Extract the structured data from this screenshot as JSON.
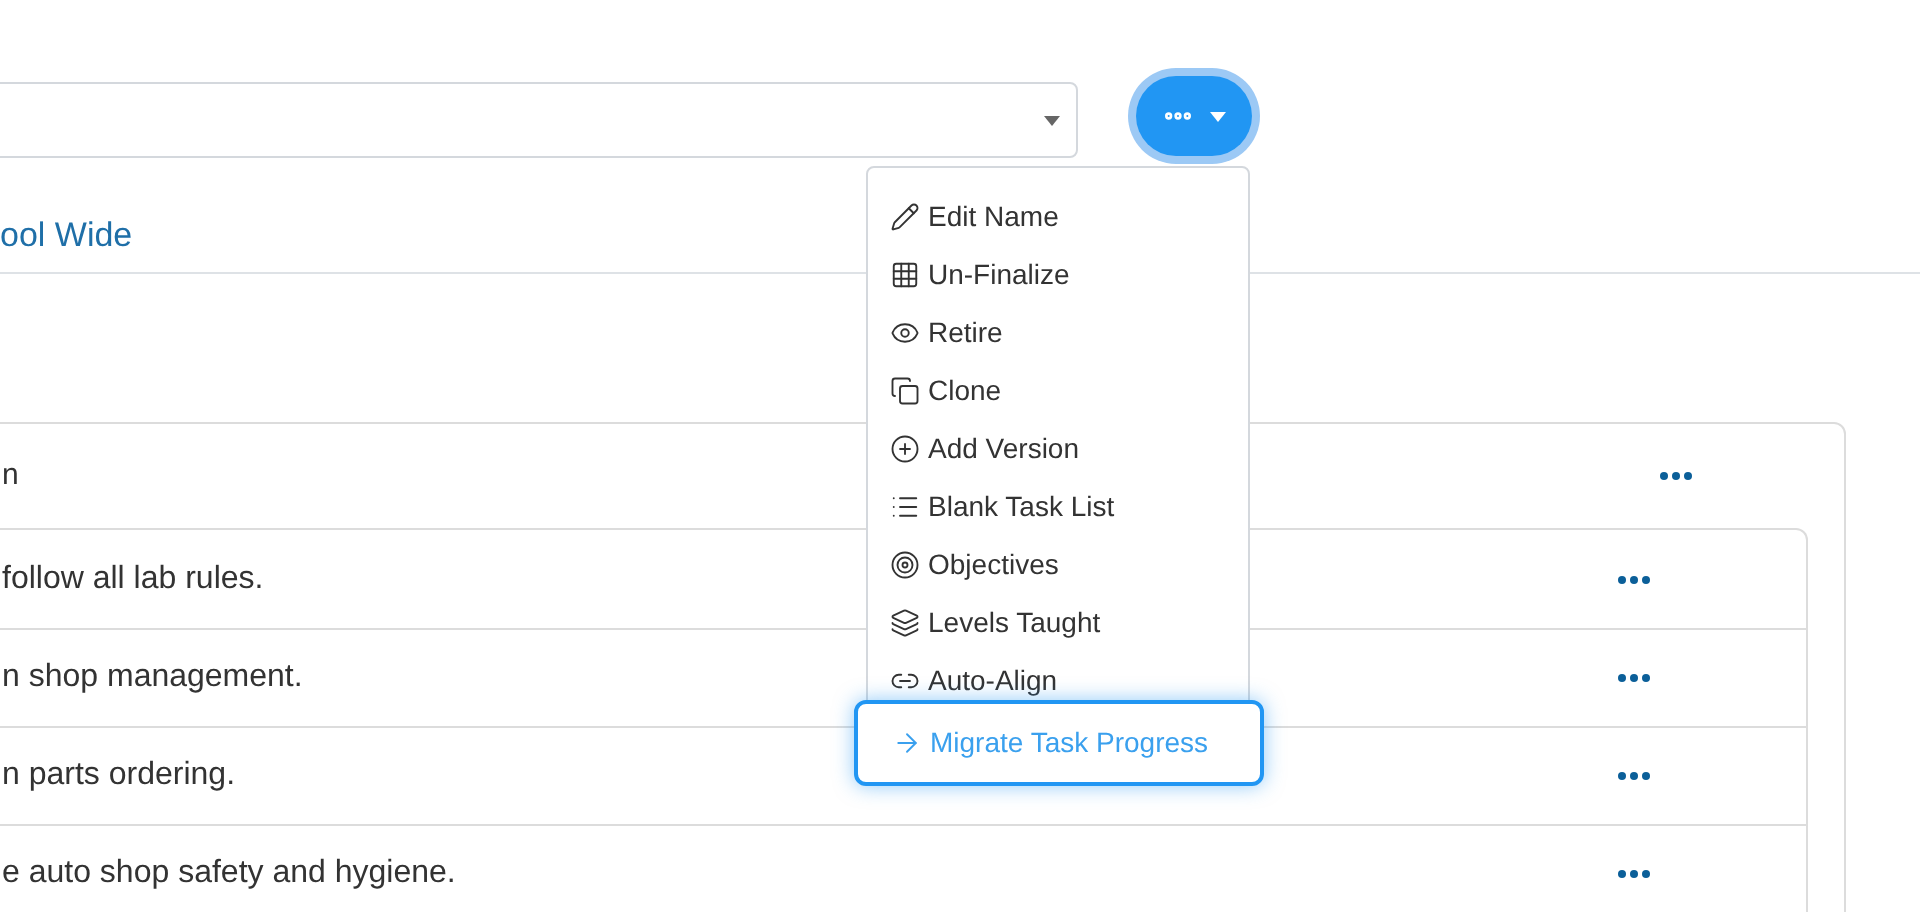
{
  "scope_link": "ool Wide",
  "card": {
    "title": "n",
    "rows": [
      {
        "text": "follow all lab rules."
      },
      {
        "text": "n shop management."
      },
      {
        "text": "n parts ordering."
      },
      {
        "text": "e auto shop safety and hygiene."
      }
    ]
  },
  "menu": {
    "items": [
      {
        "kind": "pencil",
        "label": "Edit Name",
        "selected": false
      },
      {
        "kind": "grid",
        "label": "Un-Finalize",
        "selected": false
      },
      {
        "kind": "eye",
        "label": "Retire",
        "selected": false
      },
      {
        "kind": "copy",
        "label": "Clone",
        "selected": false
      },
      {
        "kind": "plus",
        "label": "Add Version",
        "selected": false
      },
      {
        "kind": "list",
        "label": "Blank Task List",
        "selected": false
      },
      {
        "kind": "target",
        "label": "Objectives",
        "selected": false
      },
      {
        "kind": "layers",
        "label": "Levels Taught",
        "selected": false
      },
      {
        "kind": "link",
        "label": "Auto-Align",
        "selected": false
      },
      {
        "kind": "arrow",
        "label": "Migrate Task Progress",
        "selected": true
      }
    ]
  }
}
